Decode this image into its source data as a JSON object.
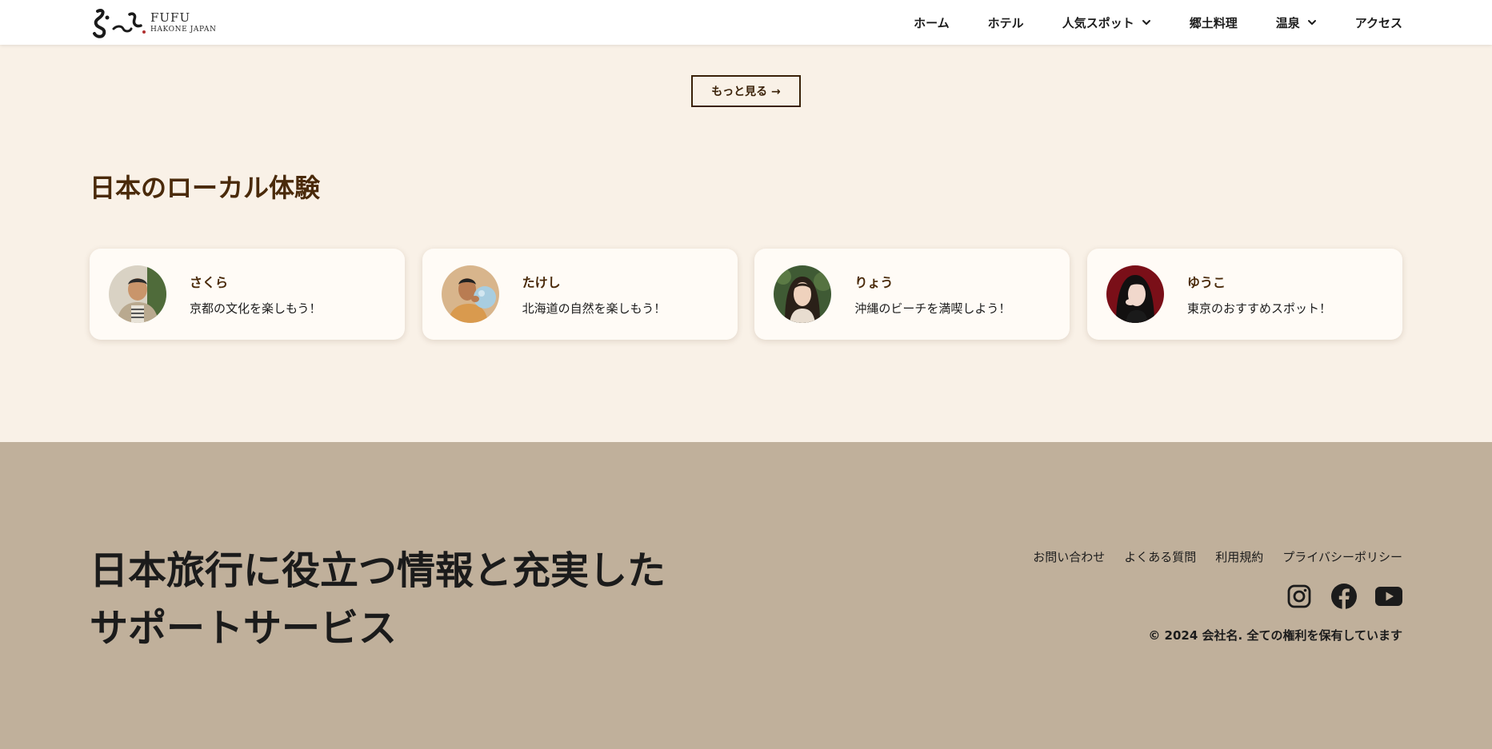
{
  "brand": {
    "name": "FUFU",
    "subtitle": "HAKONE JAPAN"
  },
  "nav": {
    "items": [
      {
        "label": "ホーム"
      },
      {
        "label": "ホテル"
      },
      {
        "label": "人気スポット",
        "has_dropdown": true
      },
      {
        "label": "郷土料理"
      },
      {
        "label": "温泉",
        "has_dropdown": true
      },
      {
        "label": "アクセス"
      }
    ]
  },
  "more_button": {
    "label": "もっと見る →"
  },
  "section": {
    "title": "日本のローカル体験"
  },
  "cards": [
    {
      "name": "さくら",
      "desc": "京都の文化を楽しもう！",
      "avatar": "man-striped-shirt-photo"
    },
    {
      "name": "たけし",
      "desc": "北海道の自然を楽しもう！",
      "avatar": "man-balloon-photo"
    },
    {
      "name": "りょう",
      "desc": "沖縄のビーチを満喫しよう！",
      "avatar": "woman-greenery-photo"
    },
    {
      "name": "ゆうこ",
      "desc": "東京のおすすめスポット！",
      "avatar": "woman-red-background-photo"
    }
  ],
  "footer": {
    "tagline_line1": "日本旅行に役立つ情報と充実した",
    "tagline_line2": "サポートサービス",
    "links": [
      "お問い合わせ",
      "よくある質問",
      "利用規約",
      "プライバシーポリシー"
    ],
    "social": [
      "instagram-icon",
      "facebook-icon",
      "youtube-icon"
    ],
    "copyright": "© 2024 会社名. 全ての権利を保有しています"
  },
  "colors": {
    "page_bg": "#f9f1e7",
    "footer_bg": "#c0b09b",
    "accent_brown": "#4a2a0a",
    "card_bg": "#fffbf6"
  }
}
